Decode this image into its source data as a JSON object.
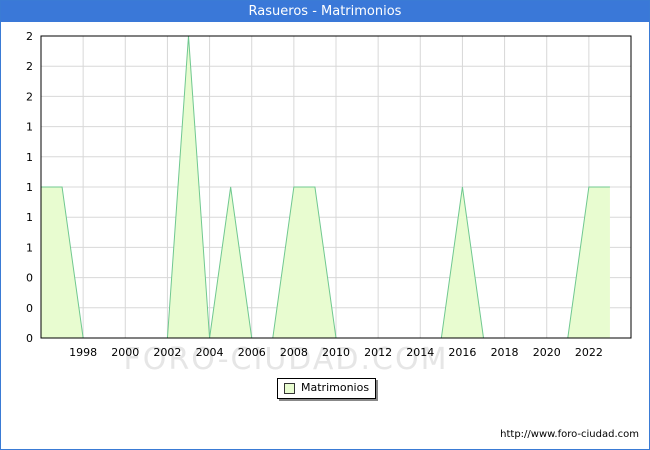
{
  "header": {
    "title": "Rasueros - Matrimonios"
  },
  "watermark": "FORO-CIUDAD.COM",
  "footer": {
    "url": "http://www.foro-ciudad.com"
  },
  "legend": {
    "label": "Matrimonios"
  },
  "colors": {
    "fill": "#e8fcd0",
    "line": "#70c890",
    "grid": "#d8d8d8",
    "titlebar": "#3a78d8"
  },
  "chart_data": {
    "type": "area",
    "title": "Rasueros - Matrimonios",
    "x": [
      1996,
      1997,
      1998,
      1999,
      2000,
      2001,
      2002,
      2003,
      2004,
      2005,
      2006,
      2007,
      2008,
      2009,
      2010,
      2011,
      2012,
      2013,
      2014,
      2015,
      2016,
      2017,
      2018,
      2019,
      2020,
      2021,
      2022,
      2023
    ],
    "series": [
      {
        "name": "Matrimonios",
        "values": [
          1,
          1,
          0,
          0,
          0,
          0,
          0,
          2,
          0,
          1,
          0,
          0,
          1,
          1,
          0,
          0,
          0,
          0,
          0,
          0,
          1,
          0,
          0,
          0,
          0,
          0,
          1,
          1
        ]
      }
    ],
    "xticks": [
      1998,
      2000,
      2002,
      2004,
      2006,
      2008,
      2010,
      2012,
      2014,
      2016,
      2018,
      2020,
      2022
    ],
    "yticks": [
      0,
      0.2,
      0.4,
      0.6,
      0.8,
      1,
      1.2,
      1.4,
      1.6,
      1.8,
      2
    ],
    "ytick_labels": [
      "0",
      "0",
      "0",
      "1",
      "1",
      "1",
      "1",
      "1",
      "2",
      "2",
      "2"
    ],
    "ylim": [
      0,
      2
    ],
    "xlim": [
      1996,
      2024
    ],
    "grid": true,
    "legend_position": "bottom-center"
  }
}
